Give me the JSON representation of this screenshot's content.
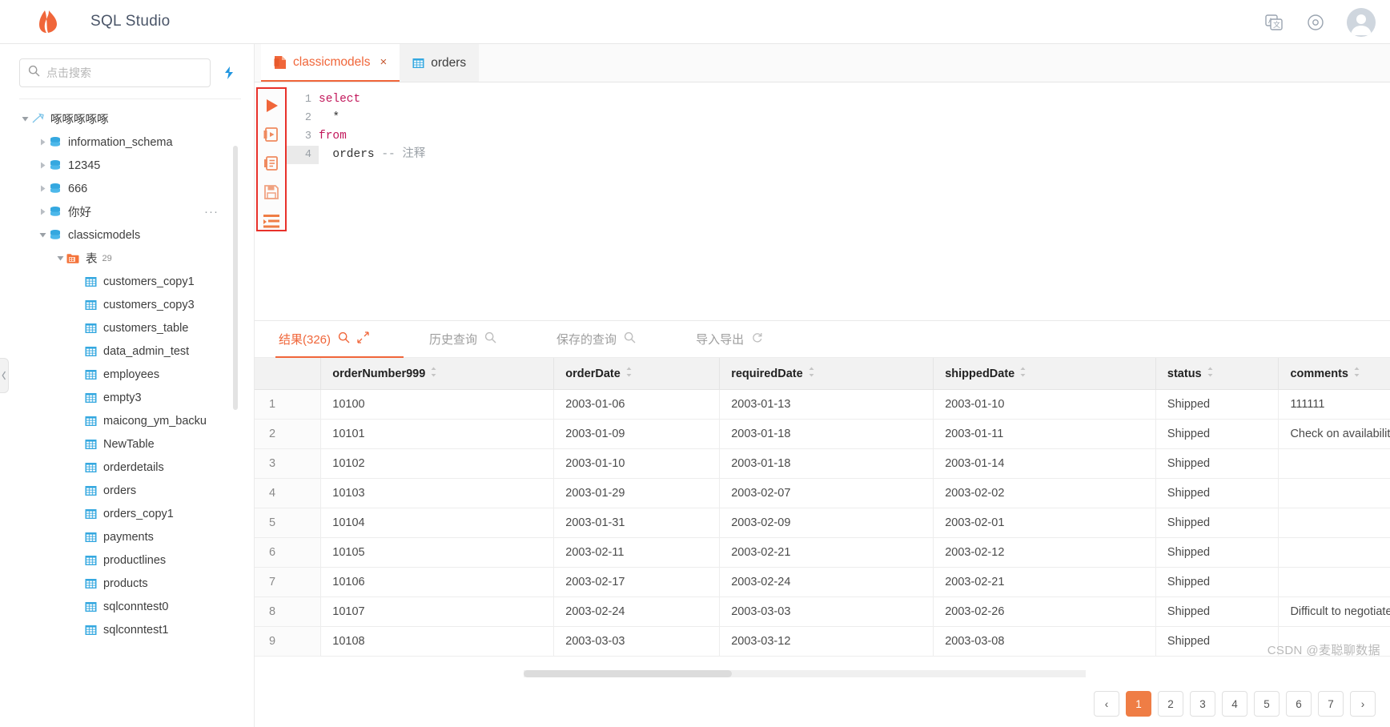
{
  "header": {
    "app_title": "SQL Studio",
    "logo_icon": "flame-logo-icon",
    "icons": [
      {
        "name": "translate-icon",
        "glyph": "文"
      },
      {
        "name": "settings-icon",
        "glyph": "⚙"
      }
    ],
    "avatar_icon": "user-avatar-icon"
  },
  "sidebar": {
    "search": {
      "placeholder": "点击搜索",
      "value": "",
      "icon": "search-icon"
    },
    "refresh_icon": "refresh-sync-icon",
    "tree": [
      {
        "label": "啄啄啄啄啄",
        "icon": "connection-icon",
        "depth": 0,
        "expanded": true,
        "caret": true,
        "dots": false
      },
      {
        "label": "information_schema",
        "icon": "database-icon",
        "depth": 1,
        "expanded": false,
        "caret": true,
        "dots": false
      },
      {
        "label": "12345",
        "icon": "database-icon",
        "depth": 1,
        "expanded": false,
        "caret": true,
        "dots": false
      },
      {
        "label": "666",
        "icon": "database-icon",
        "depth": 1,
        "expanded": false,
        "caret": true,
        "dots": false
      },
      {
        "label": "你好",
        "icon": "database-icon",
        "depth": 1,
        "expanded": false,
        "caret": true,
        "dots": true
      },
      {
        "label": "classicmodels",
        "icon": "database-icon",
        "depth": 1,
        "expanded": true,
        "caret": true,
        "dots": false
      },
      {
        "label": "表",
        "count": "29",
        "icon": "folder-icon",
        "depth": 2,
        "expanded": true,
        "caret": true,
        "dots": false
      },
      {
        "label": "customers_copy1",
        "icon": "table-icon",
        "depth": 3,
        "caret": false,
        "dots": false
      },
      {
        "label": "customers_copy3",
        "icon": "table-icon",
        "depth": 3,
        "caret": false,
        "dots": false
      },
      {
        "label": "customers_table",
        "icon": "table-icon",
        "depth": 3,
        "caret": false,
        "dots": false
      },
      {
        "label": "data_admin_test",
        "icon": "table-icon",
        "depth": 3,
        "caret": false,
        "dots": false
      },
      {
        "label": "employees",
        "icon": "table-icon",
        "depth": 3,
        "caret": false,
        "dots": false
      },
      {
        "label": "empty3",
        "icon": "table-icon",
        "depth": 3,
        "caret": false,
        "dots": false
      },
      {
        "label": "maicong_ym_backu",
        "icon": "table-icon",
        "depth": 3,
        "caret": false,
        "dots": false
      },
      {
        "label": "NewTable",
        "icon": "table-icon",
        "depth": 3,
        "caret": false,
        "dots": false
      },
      {
        "label": "orderdetails",
        "icon": "table-icon",
        "depth": 3,
        "caret": false,
        "dots": false
      },
      {
        "label": "orders",
        "icon": "table-icon",
        "depth": 3,
        "caret": false,
        "dots": false
      },
      {
        "label": "orders_copy1",
        "icon": "table-icon",
        "depth": 3,
        "caret": false,
        "dots": false
      },
      {
        "label": "payments",
        "icon": "table-icon",
        "depth": 3,
        "caret": false,
        "dots": false
      },
      {
        "label": "productlines",
        "icon": "table-icon",
        "depth": 3,
        "caret": false,
        "dots": false
      },
      {
        "label": "products",
        "icon": "table-icon",
        "depth": 3,
        "caret": false,
        "dots": false
      },
      {
        "label": "sqlconntest0",
        "icon": "table-icon",
        "depth": 3,
        "caret": false,
        "dots": false
      },
      {
        "label": "sqlconntest1",
        "icon": "table-icon",
        "depth": 3,
        "caret": false,
        "dots": false
      }
    ],
    "collapse_icon": "collapse-sidebar-icon"
  },
  "editor": {
    "tabs": [
      {
        "label": "classicmodels",
        "icon": "sql-file-icon",
        "active": true,
        "closable": true
      },
      {
        "label": "orders",
        "icon": "table-icon",
        "active": false,
        "closable": false
      }
    ],
    "toolbar": [
      {
        "name": "run-query-icon",
        "title": "运行"
      },
      {
        "name": "run-to-file-icon",
        "title": "运行并导出"
      },
      {
        "name": "explain-plan-icon",
        "title": "执行计划"
      },
      {
        "name": "save-sql-icon",
        "title": "保存"
      },
      {
        "name": "format-sql-icon",
        "title": "格式化"
      }
    ],
    "line_numbers": [
      "1",
      "2",
      "3",
      "4"
    ],
    "current_line": 4,
    "code_lines": [
      {
        "text": "select",
        "type": "keyword"
      },
      {
        "text": "  *",
        "type": "plain"
      },
      {
        "text": "from",
        "type": "keyword"
      },
      {
        "text": "  orders ",
        "type": "plain",
        "comment": "-- 注释"
      }
    ]
  },
  "results": {
    "tabs": [
      {
        "label": "结果(326)",
        "icon": "search-icon",
        "extra_icon": "expand-icon",
        "active": true
      },
      {
        "label": "历史查询",
        "icon": "search-icon",
        "active": false
      },
      {
        "label": "保存的查询",
        "icon": "search-icon",
        "active": false
      },
      {
        "label": "导入导出",
        "icon": "refresh-icon",
        "active": false
      }
    ],
    "columns": [
      "orderNumber999",
      "orderDate",
      "requiredDate",
      "shippedDate",
      "status",
      "comments"
    ],
    "rows": [
      {
        "n": "1",
        "cells": [
          "10100",
          "2003-01-06",
          "2003-01-13",
          "2003-01-10",
          "Shipped",
          "111111"
        ]
      },
      {
        "n": "2",
        "cells": [
          "10101",
          "2003-01-09",
          "2003-01-18",
          "2003-01-11",
          "Shipped",
          "Check on availability."
        ]
      },
      {
        "n": "3",
        "cells": [
          "10102",
          "2003-01-10",
          "2003-01-18",
          "2003-01-14",
          "Shipped",
          ""
        ]
      },
      {
        "n": "4",
        "cells": [
          "10103",
          "2003-01-29",
          "2003-02-07",
          "2003-02-02",
          "Shipped",
          ""
        ]
      },
      {
        "n": "5",
        "cells": [
          "10104",
          "2003-01-31",
          "2003-02-09",
          "2003-02-01",
          "Shipped",
          ""
        ]
      },
      {
        "n": "6",
        "cells": [
          "10105",
          "2003-02-11",
          "2003-02-21",
          "2003-02-12",
          "Shipped",
          ""
        ]
      },
      {
        "n": "7",
        "cells": [
          "10106",
          "2003-02-17",
          "2003-02-24",
          "2003-02-21",
          "Shipped",
          ""
        ]
      },
      {
        "n": "8",
        "cells": [
          "10107",
          "2003-02-24",
          "2003-03-03",
          "2003-02-26",
          "Shipped",
          "Difficult to negotiate with customer. We"
        ]
      },
      {
        "n": "9",
        "cells": [
          "10108",
          "2003-03-03",
          "2003-03-12",
          "2003-03-08",
          "Shipped",
          ""
        ]
      }
    ],
    "pagination": {
      "prev": "‹",
      "pages": [
        "1",
        "2",
        "3",
        "4",
        "5",
        "6",
        "7"
      ],
      "active_page": "1",
      "next": "›"
    }
  },
  "watermark": "CSDN @麦聪聊数据",
  "colors": {
    "accent": "#f0663a",
    "accent_soft": "#ef7d45",
    "highlight_border": "#e8312a",
    "db_icon": "#35a8e0",
    "table_icon": "#35a8e0",
    "folder_icon": "#f4743b",
    "keyword": "#c2185b",
    "comment": "#9aa0a6"
  }
}
